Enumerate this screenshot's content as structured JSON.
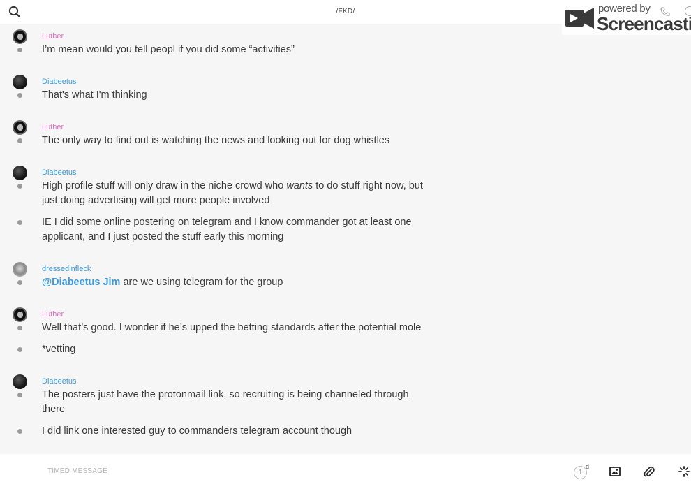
{
  "header": {
    "channel_title": "/FKD/",
    "search_icon": "search-icon"
  },
  "watermark": {
    "powered_by": "powered by",
    "brand": "Screencastify"
  },
  "messages": [
    {
      "sender": "Luther",
      "sender_color": "#e46fc1",
      "avatar": "ring",
      "lines": [
        "I’m mean would you tell peopl if you did some “activities”"
      ]
    },
    {
      "sender": "Diabeetus",
      "sender_color": "#3e9ad8",
      "avatar": "dark",
      "lines": [
        "That's what I'm thinking"
      ]
    },
    {
      "sender": "Luther",
      "sender_color": "#e46fc1",
      "avatar": "ring",
      "lines": [
        "The only way to find out is watching the news and looking out for dog whistles"
      ]
    },
    {
      "sender": "Diabeetus",
      "sender_color": "#3e9ad8",
      "avatar": "dark",
      "lines": [
        {
          "before": "High profile stuff will only draw in the niche crowd who ",
          "emphasis": "wants",
          "after": " to do stuff right now, but just doing advertising will get more people involved"
        },
        "IE I did some online postering on telegram and I know commander got at least one applicant, and I just posted the stuff early this morning"
      ]
    },
    {
      "sender": "dressedinfleck",
      "sender_color": "#3e9ad8",
      "avatar": "gray",
      "lines": [
        {
          "mention": "@Diabeetus Jim",
          "after": " are we using telegram for the group"
        }
      ]
    },
    {
      "sender": "Luther",
      "sender_color": "#e46fc1",
      "avatar": "ring",
      "lines": [
        "Well that’s good. I wonder if he’s upped the betting standards after the potential mole",
        "*vetting"
      ]
    },
    {
      "sender": "Diabeetus",
      "sender_color": "#3e9ad8",
      "avatar": "dark",
      "lines": [
        "The posters just have the protonmail link, so recruiting is being channeled through there",
        "I did link one interested guy to commanders telegram account though"
      ]
    }
  ],
  "composer": {
    "placeholder": "TIMED MESSAGE",
    "timer_value": "1",
    "timer_unit": "d",
    "icons": [
      "image-icon",
      "paperclip-icon",
      "spinner-icon"
    ]
  },
  "colors": {
    "background": "#f6f6f6",
    "luther_name": "#e46fc1",
    "diabeetus_name": "#3e9ad8"
  }
}
